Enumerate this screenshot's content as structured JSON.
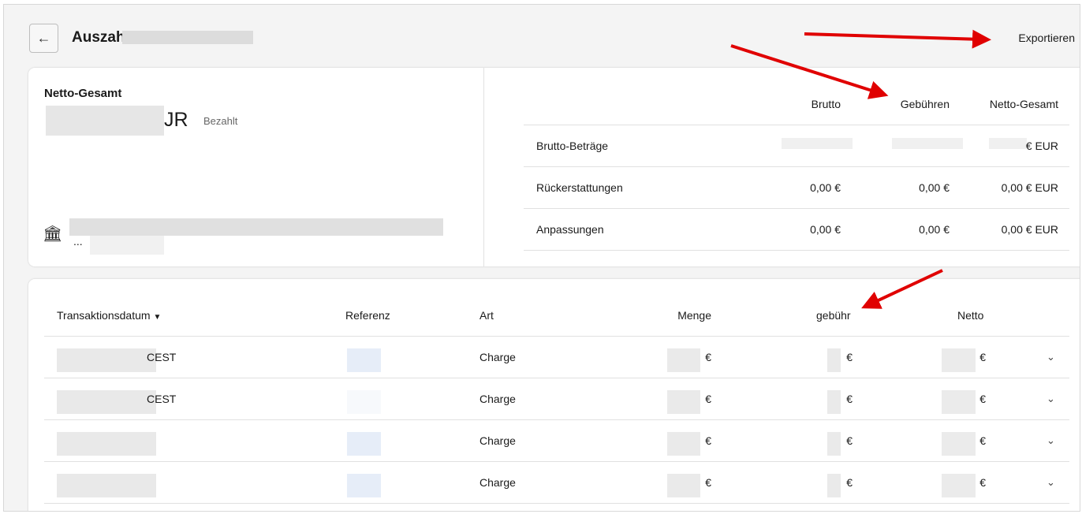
{
  "header": {
    "back_icon": "arrow-left-icon",
    "title": "Auszah",
    "export_label": "Exportieren"
  },
  "summary": {
    "label": "Netto-Gesamt",
    "amount_suffix": "JR",
    "status": "Bezahlt",
    "bank_icon": "bank-icon",
    "bank_ellipsis": "..."
  },
  "breakdown": {
    "columns": [
      "Brutto",
      "Gebühren",
      "Netto-Gesamt"
    ],
    "rows": [
      {
        "label": "Brutto-Beträge",
        "brutto": "",
        "fees": "",
        "net": "€ EUR"
      },
      {
        "label": "Rückerstattungen",
        "brutto": "0,00 €",
        "fees": "0,00 €",
        "net": "0,00 € EUR"
      },
      {
        "label": "Anpassungen",
        "brutto": "0,00 €",
        "fees": "0,00 €",
        "net": "0,00 € EUR"
      }
    ]
  },
  "transactions": {
    "columns": {
      "date": "Transaktionsdatum",
      "reference": "Referenz",
      "type": "Art",
      "amount": "Menge",
      "fee": "gebühr",
      "net": "Netto"
    },
    "rows": [
      {
        "date": "CEST",
        "type": "Charge",
        "amount": "€",
        "fee": "€",
        "net": "€"
      },
      {
        "date": "CEST",
        "type": "Charge",
        "amount": "€",
        "fee": "€",
        "net": "€"
      },
      {
        "date": "",
        "type": "Charge",
        "amount": "€",
        "fee": "€",
        "net": "€"
      },
      {
        "date": "",
        "type": "Charge",
        "amount": "€",
        "fee": "€",
        "net": "€"
      }
    ]
  },
  "colors": {
    "annotation_arrow": "#e00000"
  }
}
